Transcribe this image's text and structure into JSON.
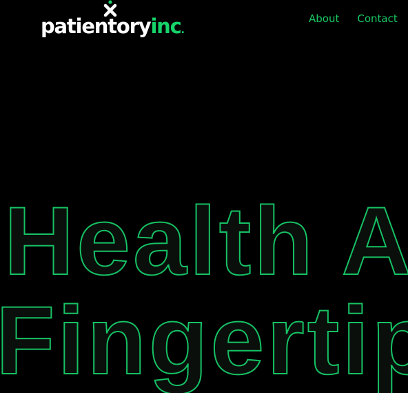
{
  "brand": {
    "name_part1": "patientory",
    "name_part2": "inc",
    "name_dot": ".",
    "icon": "cross-logo-icon",
    "accent_color": "#16d36a"
  },
  "nav": {
    "items": [
      {
        "label": "About"
      },
      {
        "label": "Contact"
      }
    ]
  },
  "hero": {
    "line1": "Health A",
    "line2": "Fingertip",
    "stroke_color": "#16c264"
  }
}
